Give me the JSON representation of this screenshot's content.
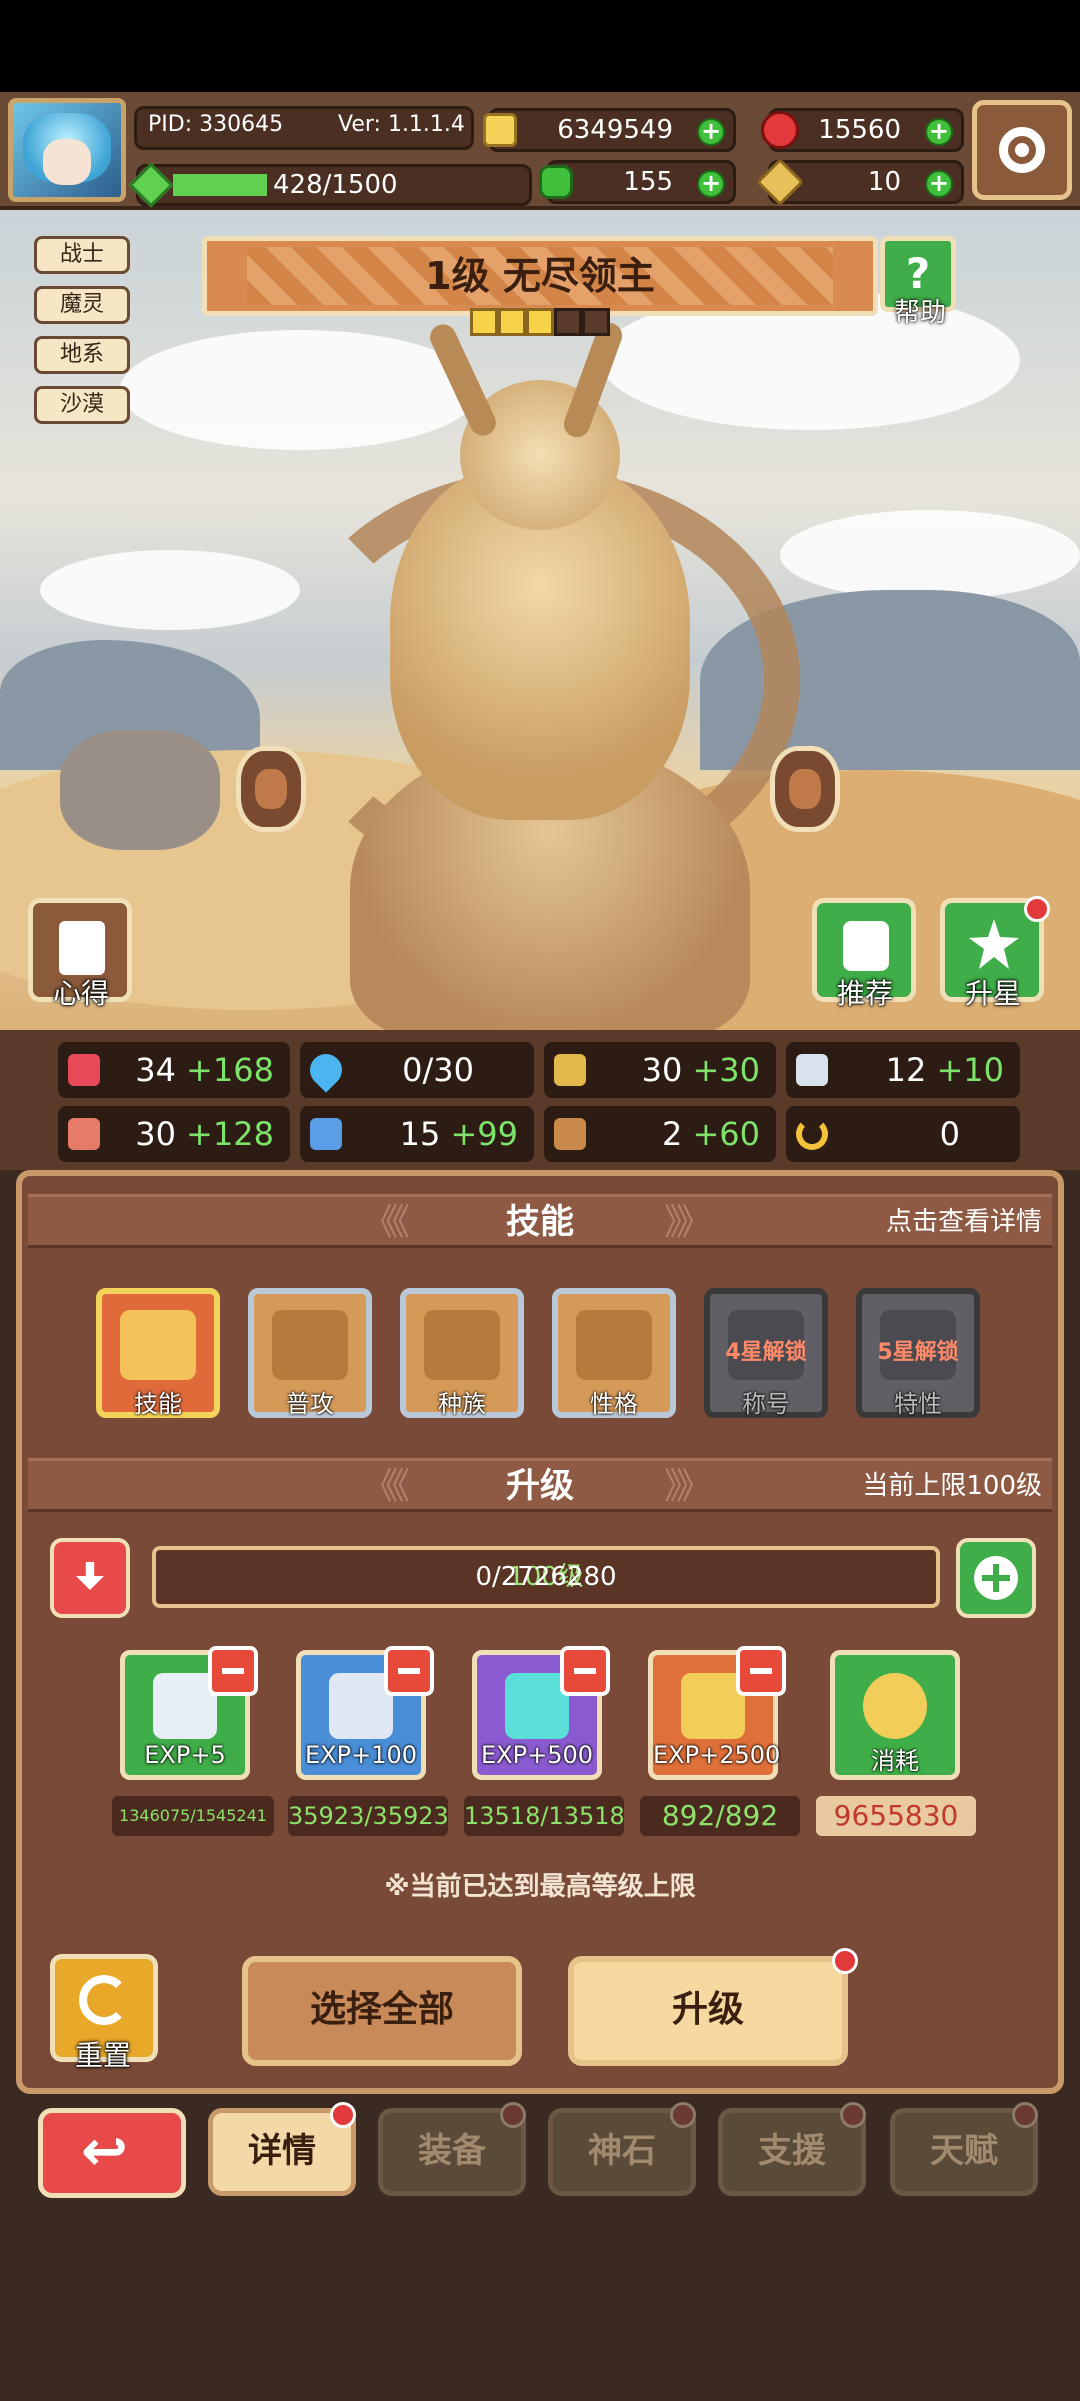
{
  "topbar": {
    "pid": "PID: 330645",
    "version": "Ver: 1.1.1.4",
    "exp": "428/1500",
    "exp_fraction": 0.285,
    "gold": "6349549",
    "gems": "15560",
    "clovers": "155",
    "tickets": "10"
  },
  "tags": [
    "战士",
    "魔灵",
    "地系",
    "沙漠"
  ],
  "boss": {
    "title": "1级  无尽领主",
    "stars_filled": 3,
    "stars_total": 5,
    "help_label": "帮助",
    "insight_label": "心得",
    "recommend_label": "推荐",
    "upgrade_star_label": "升星"
  },
  "stats": [
    {
      "base": "34",
      "bonus": "+168"
    },
    {
      "base": "0/30",
      "bonus": ""
    },
    {
      "base": "30",
      "bonus": "+30"
    },
    {
      "base": "12",
      "bonus": "+10"
    },
    {
      "base": "30",
      "bonus": "+128"
    },
    {
      "base": "15",
      "bonus": "+99"
    },
    {
      "base": "2",
      "bonus": "+60"
    },
    {
      "base": "0",
      "bonus": ""
    }
  ],
  "skills_section": {
    "title": "技能",
    "hint": "点击查看详情",
    "items": [
      {
        "label": "技能",
        "lock": ""
      },
      {
        "label": "普攻",
        "lock": ""
      },
      {
        "label": "种族",
        "lock": ""
      },
      {
        "label": "性格",
        "lock": ""
      },
      {
        "label": "称号",
        "lock": "4星解锁"
      },
      {
        "label": "特性",
        "lock": "5星解锁"
      }
    ]
  },
  "level_section": {
    "title": "升级",
    "hint": "当前上限100级",
    "level": "100级",
    "progress": "0/2726280",
    "items": [
      {
        "label": "EXP+5",
        "count": "1346075/1545241"
      },
      {
        "label": "EXP+100",
        "count": "35923/35923"
      },
      {
        "label": "EXP+500",
        "count": "13518/13518"
      },
      {
        "label": "EXP+2500",
        "count": "892/892"
      },
      {
        "label": "消耗",
        "count": "9655830"
      }
    ],
    "note": "※当前已达到最高等级上限",
    "reset_label": "重置",
    "select_all_label": "选择全部",
    "upgrade_label": "升级"
  },
  "tabs": [
    "详情",
    "装备",
    "神石",
    "支援",
    "天赋"
  ]
}
